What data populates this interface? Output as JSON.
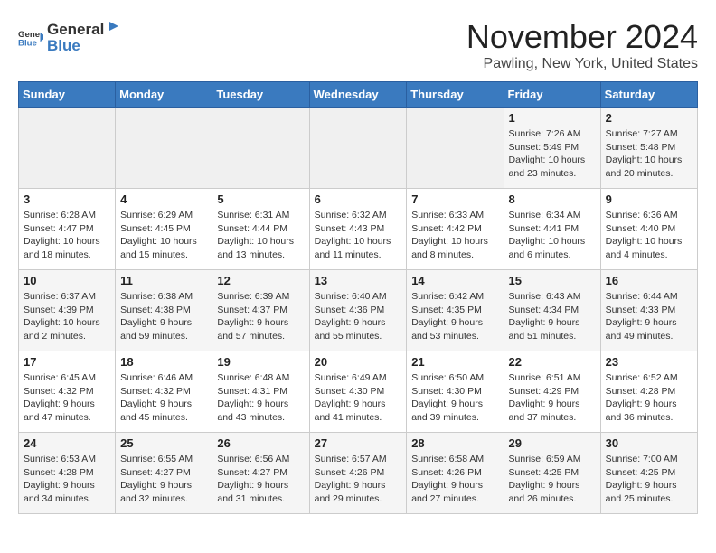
{
  "app": {
    "name": "GeneralBlue",
    "logo_icon": "▶"
  },
  "header": {
    "month": "November 2024",
    "location": "Pawling, New York, United States"
  },
  "weekdays": [
    "Sunday",
    "Monday",
    "Tuesday",
    "Wednesday",
    "Thursday",
    "Friday",
    "Saturday"
  ],
  "weeks": [
    [
      {
        "day": "",
        "info": ""
      },
      {
        "day": "",
        "info": ""
      },
      {
        "day": "",
        "info": ""
      },
      {
        "day": "",
        "info": ""
      },
      {
        "day": "",
        "info": ""
      },
      {
        "day": "1",
        "info": "Sunrise: 7:26 AM\nSunset: 5:49 PM\nDaylight: 10 hours and 23 minutes."
      },
      {
        "day": "2",
        "info": "Sunrise: 7:27 AM\nSunset: 5:48 PM\nDaylight: 10 hours and 20 minutes."
      }
    ],
    [
      {
        "day": "3",
        "info": "Sunrise: 6:28 AM\nSunset: 4:47 PM\nDaylight: 10 hours and 18 minutes."
      },
      {
        "day": "4",
        "info": "Sunrise: 6:29 AM\nSunset: 4:45 PM\nDaylight: 10 hours and 15 minutes."
      },
      {
        "day": "5",
        "info": "Sunrise: 6:31 AM\nSunset: 4:44 PM\nDaylight: 10 hours and 13 minutes."
      },
      {
        "day": "6",
        "info": "Sunrise: 6:32 AM\nSunset: 4:43 PM\nDaylight: 10 hours and 11 minutes."
      },
      {
        "day": "7",
        "info": "Sunrise: 6:33 AM\nSunset: 4:42 PM\nDaylight: 10 hours and 8 minutes."
      },
      {
        "day": "8",
        "info": "Sunrise: 6:34 AM\nSunset: 4:41 PM\nDaylight: 10 hours and 6 minutes."
      },
      {
        "day": "9",
        "info": "Sunrise: 6:36 AM\nSunset: 4:40 PM\nDaylight: 10 hours and 4 minutes."
      }
    ],
    [
      {
        "day": "10",
        "info": "Sunrise: 6:37 AM\nSunset: 4:39 PM\nDaylight: 10 hours and 2 minutes."
      },
      {
        "day": "11",
        "info": "Sunrise: 6:38 AM\nSunset: 4:38 PM\nDaylight: 9 hours and 59 minutes."
      },
      {
        "day": "12",
        "info": "Sunrise: 6:39 AM\nSunset: 4:37 PM\nDaylight: 9 hours and 57 minutes."
      },
      {
        "day": "13",
        "info": "Sunrise: 6:40 AM\nSunset: 4:36 PM\nDaylight: 9 hours and 55 minutes."
      },
      {
        "day": "14",
        "info": "Sunrise: 6:42 AM\nSunset: 4:35 PM\nDaylight: 9 hours and 53 minutes."
      },
      {
        "day": "15",
        "info": "Sunrise: 6:43 AM\nSunset: 4:34 PM\nDaylight: 9 hours and 51 minutes."
      },
      {
        "day": "16",
        "info": "Sunrise: 6:44 AM\nSunset: 4:33 PM\nDaylight: 9 hours and 49 minutes."
      }
    ],
    [
      {
        "day": "17",
        "info": "Sunrise: 6:45 AM\nSunset: 4:32 PM\nDaylight: 9 hours and 47 minutes."
      },
      {
        "day": "18",
        "info": "Sunrise: 6:46 AM\nSunset: 4:32 PM\nDaylight: 9 hours and 45 minutes."
      },
      {
        "day": "19",
        "info": "Sunrise: 6:48 AM\nSunset: 4:31 PM\nDaylight: 9 hours and 43 minutes."
      },
      {
        "day": "20",
        "info": "Sunrise: 6:49 AM\nSunset: 4:30 PM\nDaylight: 9 hours and 41 minutes."
      },
      {
        "day": "21",
        "info": "Sunrise: 6:50 AM\nSunset: 4:30 PM\nDaylight: 9 hours and 39 minutes."
      },
      {
        "day": "22",
        "info": "Sunrise: 6:51 AM\nSunset: 4:29 PM\nDaylight: 9 hours and 37 minutes."
      },
      {
        "day": "23",
        "info": "Sunrise: 6:52 AM\nSunset: 4:28 PM\nDaylight: 9 hours and 36 minutes."
      }
    ],
    [
      {
        "day": "24",
        "info": "Sunrise: 6:53 AM\nSunset: 4:28 PM\nDaylight: 9 hours and 34 minutes."
      },
      {
        "day": "25",
        "info": "Sunrise: 6:55 AM\nSunset: 4:27 PM\nDaylight: 9 hours and 32 minutes."
      },
      {
        "day": "26",
        "info": "Sunrise: 6:56 AM\nSunset: 4:27 PM\nDaylight: 9 hours and 31 minutes."
      },
      {
        "day": "27",
        "info": "Sunrise: 6:57 AM\nSunset: 4:26 PM\nDaylight: 9 hours and 29 minutes."
      },
      {
        "day": "28",
        "info": "Sunrise: 6:58 AM\nSunset: 4:26 PM\nDaylight: 9 hours and 27 minutes."
      },
      {
        "day": "29",
        "info": "Sunrise: 6:59 AM\nSunset: 4:25 PM\nDaylight: 9 hours and 26 minutes."
      },
      {
        "day": "30",
        "info": "Sunrise: 7:00 AM\nSunset: 4:25 PM\nDaylight: 9 hours and 25 minutes."
      }
    ]
  ]
}
